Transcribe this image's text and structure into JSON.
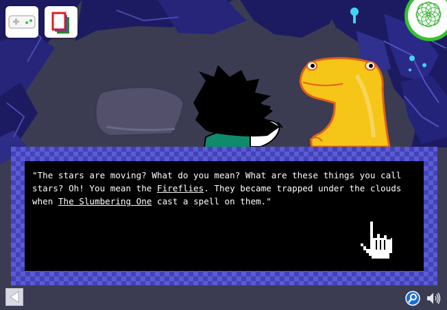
{
  "toolbar": {
    "gamepad_icon": "gamepad-icon",
    "pages_icon": "pages-icon",
    "spiral_icon": "spirograph-icon"
  },
  "dialog": {
    "segments": [
      {
        "text": "\"The stars are moving? What do you mean? What are these things you call stars? Oh! You mean the ",
        "link": false
      },
      {
        "text": "Fireflies",
        "link": true
      },
      {
        "text": ". They became trapped under the clouds when ",
        "link": false
      },
      {
        "text": "The Slumbering One",
        "link": true
      },
      {
        "text": " cast a spell on them.\"",
        "link": false
      }
    ]
  },
  "colors": {
    "frame_light": "#5b5bd6",
    "frame_dark": "#4343b8",
    "dialog_bg": "#000000",
    "dialog_text": "#ffffff",
    "creature": "#f5c518",
    "creature_outline": "#e0601a",
    "cave_bg": "#3b3c52",
    "crystal": "#1e1e6e",
    "accent_green": "#35c22f"
  },
  "bottom_bar": {
    "back_icon": "back-arrow-icon",
    "zoom_icon": "magnifier-icon",
    "sound_icon": "speaker-icon"
  }
}
